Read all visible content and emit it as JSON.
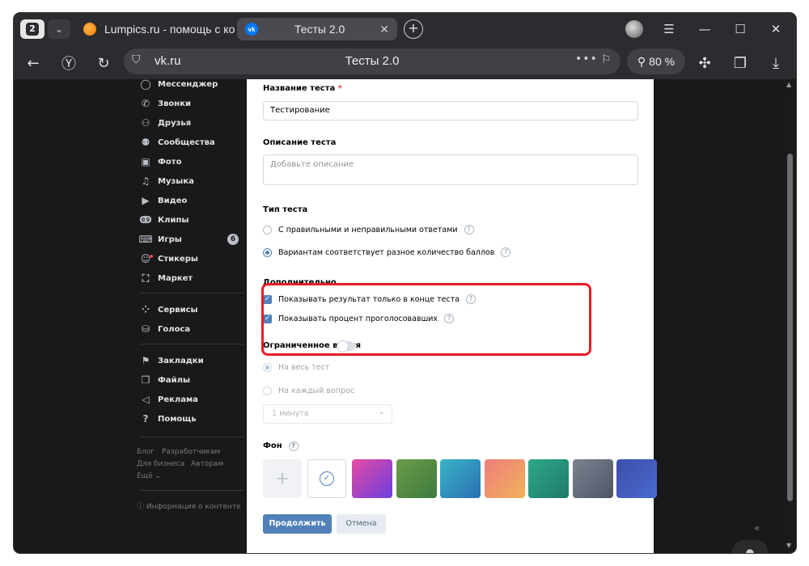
{
  "browser": {
    "tab_count": "2",
    "tabs": [
      {
        "label": "Lumpics.ru - помощь с ко"
      },
      {
        "label": "Тесты 2.0"
      }
    ],
    "address": {
      "domain": "vk.ru",
      "page_title": "Тесты 2.0"
    },
    "zoom": "80 %"
  },
  "sidebar": {
    "items": [
      {
        "label": "Мессенджер",
        "icon": "message-icon",
        "glyph": "◯"
      },
      {
        "label": "Звонки",
        "icon": "phone-icon",
        "glyph": "✆"
      },
      {
        "label": "Друзья",
        "icon": "friends-icon",
        "glyph": "⚇"
      },
      {
        "label": "Сообщества",
        "icon": "communities-icon",
        "glyph": "⚉"
      },
      {
        "label": "Фото",
        "icon": "photo-icon",
        "glyph": "▣"
      },
      {
        "label": "Музыка",
        "icon": "music-icon",
        "glyph": "♫"
      },
      {
        "label": "Видео",
        "icon": "video-icon",
        "glyph": "▶"
      },
      {
        "label": "Клипы",
        "icon": "clips-icon",
        "glyph": "ↂ"
      },
      {
        "label": "Игры",
        "icon": "games-icon",
        "glyph": "⌨",
        "badge": "6"
      },
      {
        "label": "Стикеры",
        "icon": "stickers-icon",
        "glyph": "☺"
      },
      {
        "label": "Маркет",
        "icon": "market-icon",
        "glyph": "⛶"
      },
      {
        "label": "Сервисы",
        "icon": "services-icon",
        "glyph": "⁘"
      },
      {
        "label": "Голоса",
        "icon": "votes-icon",
        "glyph": "⛁"
      },
      {
        "label": "Закладки",
        "icon": "bookmarks-icon",
        "glyph": "⚑"
      },
      {
        "label": "Файлы",
        "icon": "files-icon",
        "glyph": "❒"
      },
      {
        "label": "Реклама",
        "icon": "ads-icon",
        "glyph": "◁"
      },
      {
        "label": "Помощь",
        "icon": "help-icon",
        "glyph": "?"
      }
    ],
    "footer": {
      "blog": "Блог",
      "developers": "Разработчикам",
      "business": "Для бизнеса",
      "authors": "Авторам",
      "more": "Ещё ⌄",
      "content_info": "Информация о контенте"
    }
  },
  "form": {
    "name_label": "Название теста",
    "name_required": "*",
    "name_value": "Тестирование",
    "description_label": "Описание теста",
    "description_placeholder": "Добавьте описание",
    "type_label": "Тип теста",
    "type_options": [
      {
        "label": "С правильными и неправильными ответами",
        "selected": false
      },
      {
        "label": "Вариантам соответствует разное количество баллов",
        "selected": true
      }
    ],
    "extra_label": "Дополнительно",
    "extra_options": [
      {
        "label": "Показывать результат только в конце теста",
        "checked": true
      },
      {
        "label": "Показывать процент проголосовавших",
        "checked": true
      }
    ],
    "time_label": "Ограниченное время",
    "time_options": [
      {
        "label": "На весь тест",
        "selected": true
      },
      {
        "label": "На каждый вопрос",
        "selected": false
      }
    ],
    "duration_value": "1 минута",
    "background_label": "Фон",
    "background_swatches": [
      {
        "name": "pink-purple",
        "from": "#e64aa3",
        "to": "#6b3fe0"
      },
      {
        "name": "green",
        "from": "#6a9c48",
        "to": "#3e7a3f"
      },
      {
        "name": "teal-blue",
        "from": "#3ab4c8",
        "to": "#2a6fb3"
      },
      {
        "name": "coral-orange",
        "from": "#ef7c7c",
        "to": "#f0b35a"
      },
      {
        "name": "emerald",
        "from": "#2ea88a",
        "to": "#1f7a68"
      },
      {
        "name": "slate",
        "from": "#7a8290",
        "to": "#4e5564"
      },
      {
        "name": "indigo",
        "from": "#3c4eaa",
        "to": "#4a6ad0"
      }
    ],
    "continue_label": "Продолжить",
    "cancel_label": "Отмена",
    "help_mark": "?"
  },
  "colors": {
    "accent": "#5181b8",
    "highlight": "#e81d25",
    "sidebar_bg": "#19191a"
  }
}
